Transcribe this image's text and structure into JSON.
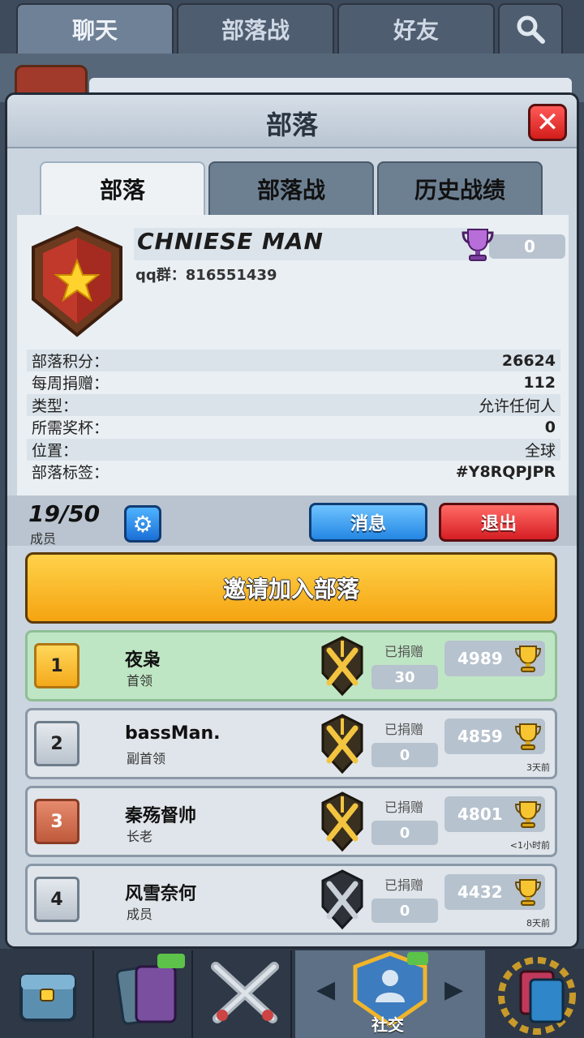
{
  "top_tabs": [
    {
      "label": "聊天"
    },
    {
      "label": "部落战"
    },
    {
      "label": "好友"
    }
  ],
  "dialog": {
    "title": "部落",
    "tabs": [
      {
        "label": "部落"
      },
      {
        "label": "部落战"
      },
      {
        "label": "历史战绩"
      }
    ]
  },
  "clan": {
    "name": "CHNIESE MAN",
    "description": "qq群：816551439",
    "war_trophies": "0",
    "stats": [
      {
        "label": "部落积分：",
        "value": "26624"
      },
      {
        "label": "每周捐赠：",
        "value": "112"
      },
      {
        "label": "类型：",
        "value": "允许任何人"
      },
      {
        "label": "所需奖杯：",
        "value": "0"
      },
      {
        "label": "位置：",
        "value": "全球"
      },
      {
        "label": "部落标签：",
        "value": "#Y8RQPJPR"
      }
    ]
  },
  "members_bar": {
    "count": "19/50",
    "label": "成员",
    "message_label": "消息",
    "exit_label": "退出"
  },
  "invite_label": "邀请加入部落",
  "members": [
    {
      "rank": "1",
      "name": "夜枭",
      "role": "首领",
      "donated_label": "已捐赠",
      "donated": "30",
      "trophies": "4989",
      "last_seen": ""
    },
    {
      "rank": "2",
      "name": "bassMan.",
      "role": "副首领",
      "donated_label": "已捐赠",
      "donated": "0",
      "trophies": "4859",
      "last_seen": "3天前"
    },
    {
      "rank": "3",
      "name": "秦殇督帅",
      "role": "长老",
      "donated_label": "已捐赠",
      "donated": "0",
      "trophies": "4801",
      "last_seen": "<1小时前"
    },
    {
      "rank": "4",
      "name": "风雪奈何",
      "role": "成员",
      "donated_label": "已捐赠",
      "donated": "0",
      "trophies": "4432",
      "last_seen": "8天前"
    }
  ],
  "bottom_nav": {
    "social_label": "社交"
  },
  "colors": {
    "gold": "#f5a411",
    "blue": "#2487e3",
    "red": "#d61e24",
    "panel": "#eaeff3"
  }
}
